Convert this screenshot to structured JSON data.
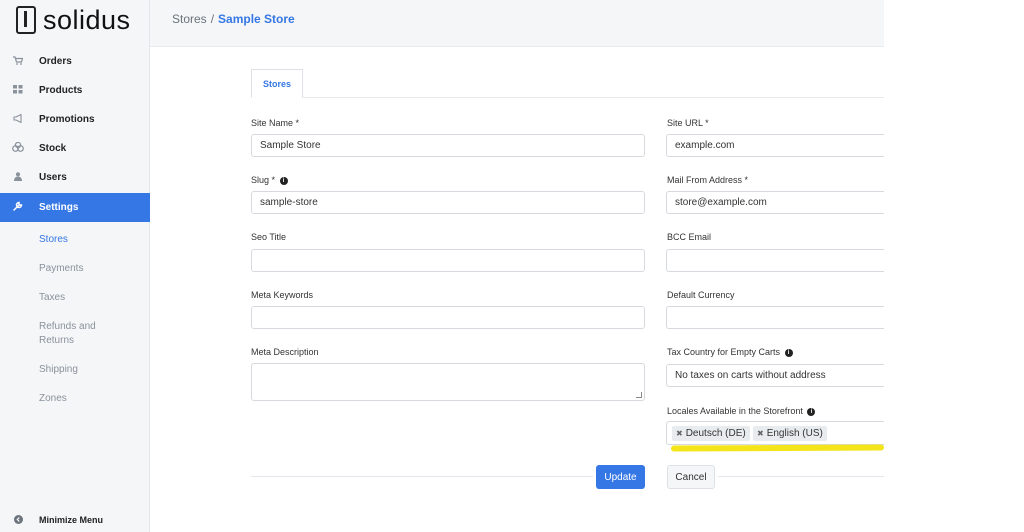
{
  "brand": {
    "name": "solidus"
  },
  "breadcrumb": {
    "root": "Stores",
    "separator": "/",
    "current": "Sample Store"
  },
  "nav": {
    "items": [
      {
        "label": "Orders",
        "icon": "cart-icon"
      },
      {
        "label": "Products",
        "icon": "grid-icon"
      },
      {
        "label": "Promotions",
        "icon": "megaphone-icon"
      },
      {
        "label": "Stock",
        "icon": "cubes-icon"
      },
      {
        "label": "Users",
        "icon": "user-icon"
      },
      {
        "label": "Settings",
        "icon": "wrench-icon",
        "active": true
      }
    ],
    "subitems": [
      {
        "label": "Stores",
        "active": true
      },
      {
        "label": "Payments"
      },
      {
        "label": "Taxes"
      },
      {
        "label": "Refunds and Returns"
      },
      {
        "label": "Shipping"
      },
      {
        "label": "Zones"
      }
    ],
    "minimize_label": "Minimize Menu"
  },
  "tabs": [
    {
      "label": "Stores",
      "active": true
    }
  ],
  "form": {
    "site_name": {
      "label": "Site Name *",
      "value": "Sample Store"
    },
    "site_url": {
      "label": "Site URL *",
      "value": "example.com"
    },
    "slug": {
      "label": "Slug *",
      "value": "sample-store"
    },
    "mail_from": {
      "label": "Mail From Address *",
      "value": "store@example.com"
    },
    "seo_title": {
      "label": "Seo Title",
      "value": ""
    },
    "bcc_email": {
      "label": "BCC Email",
      "value": ""
    },
    "meta_keywords": {
      "label": "Meta Keywords",
      "value": ""
    },
    "default_currency": {
      "label": "Default Currency",
      "value": ""
    },
    "meta_description": {
      "label": "Meta Description",
      "value": ""
    },
    "tax_country": {
      "label": "Tax Country for Empty Carts",
      "value": "No taxes on carts without address"
    },
    "locales": {
      "label": "Locales Available in the Storefront",
      "chips": [
        "Deutsch (DE)",
        "English (US)"
      ]
    }
  },
  "actions": {
    "update_label": "Update",
    "cancel_label": "Cancel"
  },
  "colors": {
    "accent": "#3577e5",
    "sidebar_bg": "#f4f6f8",
    "highlight": "#f4e41a"
  }
}
